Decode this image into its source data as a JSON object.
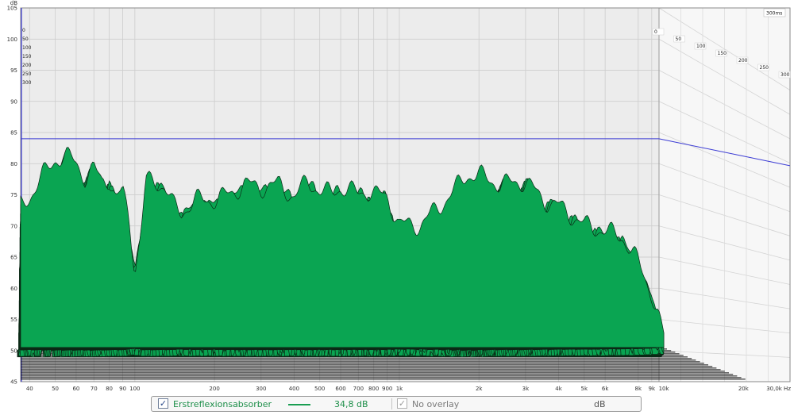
{
  "chart_data": {
    "type": "area",
    "subtype": "waterfall",
    "units": {
      "y": "dB",
      "x": "Hz",
      "z": "ms"
    },
    "xscale": "log",
    "xlim": [
      37,
      30000
    ],
    "ylim": [
      45,
      105
    ],
    "ytick_labels": [
      "105",
      "100",
      "95",
      "90",
      "85",
      "80",
      "75",
      "70",
      "65",
      "60",
      "55",
      "50",
      "45"
    ],
    "yunit_label": "dB",
    "xtick_labels": [
      {
        "f": 40,
        "t": "40"
      },
      {
        "f": 50,
        "t": "50"
      },
      {
        "f": 60,
        "t": "60"
      },
      {
        "f": 70,
        "t": "70"
      },
      {
        "f": 80,
        "t": "80"
      },
      {
        "f": 90,
        "t": "90"
      },
      {
        "f": 100,
        "t": "100"
      },
      {
        "f": 200,
        "t": "200"
      },
      {
        "f": 300,
        "t": "300"
      },
      {
        "f": 400,
        "t": "400"
      },
      {
        "f": 500,
        "t": "500"
      },
      {
        "f": 600,
        "t": "600"
      },
      {
        "f": 700,
        "t": "700"
      },
      {
        "f": 800,
        "t": "800"
      },
      {
        "f": 900,
        "t": "900"
      },
      {
        "f": 1000,
        "t": "1k"
      },
      {
        "f": 2000,
        "t": "2k"
      },
      {
        "f": 3000,
        "t": "3k"
      },
      {
        "f": 4000,
        "t": "4k"
      },
      {
        "f": 5000,
        "t": "5k"
      },
      {
        "f": 6000,
        "t": "6k"
      },
      {
        "f": 8000,
        "t": "8k"
      },
      {
        "f": 9000,
        "t": "9k"
      },
      {
        "f": 10000,
        "t": "10k"
      },
      {
        "f": 20000,
        "t": "20k"
      },
      {
        "f": 30000,
        "t": "30,0k Hz"
      }
    ],
    "time_slices_ms": [
      "0",
      "50",
      "100",
      "150",
      "200",
      "250",
      "300"
    ],
    "time_end_label": "300ms",
    "reference_level_db": 84,
    "slice_count": 32,
    "fill_color": "#0aa552",
    "edge_color": "#0b2a16",
    "reference_line_color": "#3b3bd4",
    "envelope_front": [
      [
        37,
        75
      ],
      [
        40,
        76.5
      ],
      [
        45,
        80
      ],
      [
        50,
        82.5
      ],
      [
        55,
        83
      ],
      [
        60,
        82
      ],
      [
        65,
        79.5
      ],
      [
        70,
        81
      ],
      [
        75,
        79
      ],
      [
        80,
        79.5
      ],
      [
        85,
        76
      ],
      [
        90,
        77.5
      ],
      [
        95,
        73
      ],
      [
        100,
        65
      ],
      [
        105,
        70
      ],
      [
        110,
        79
      ],
      [
        120,
        79
      ],
      [
        130,
        78
      ],
      [
        140,
        75
      ],
      [
        150,
        74
      ],
      [
        170,
        76
      ],
      [
        200,
        76
      ],
      [
        230,
        77
      ],
      [
        260,
        78.5
      ],
      [
        300,
        78
      ],
      [
        350,
        78.5
      ],
      [
        400,
        76.5
      ],
      [
        450,
        79
      ],
      [
        500,
        77.5
      ],
      [
        550,
        77
      ],
      [
        600,
        78
      ],
      [
        650,
        77.5
      ],
      [
        700,
        77
      ],
      [
        750,
        77.5
      ],
      [
        800,
        77
      ],
      [
        900,
        76.5
      ],
      [
        1000,
        72
      ],
      [
        1200,
        72
      ],
      [
        1500,
        76
      ],
      [
        1800,
        80
      ],
      [
        2000,
        80
      ],
      [
        2400,
        78.5
      ],
      [
        3000,
        79
      ],
      [
        3500,
        76
      ],
      [
        4000,
        75
      ],
      [
        5000,
        72
      ],
      [
        6000,
        71
      ],
      [
        7000,
        70
      ],
      [
        8000,
        66
      ],
      [
        9000,
        61
      ],
      [
        10000,
        54
      ]
    ],
    "nearest_slice_floor_db": 50.5
  },
  "legend": {
    "measurement_name": "Erstreflexionsabsorber",
    "level_value": "34,8 dB",
    "overlay_label": "No overlay",
    "unit": "dB",
    "check_glyph": "✓",
    "line_color": "#1a9e52"
  }
}
